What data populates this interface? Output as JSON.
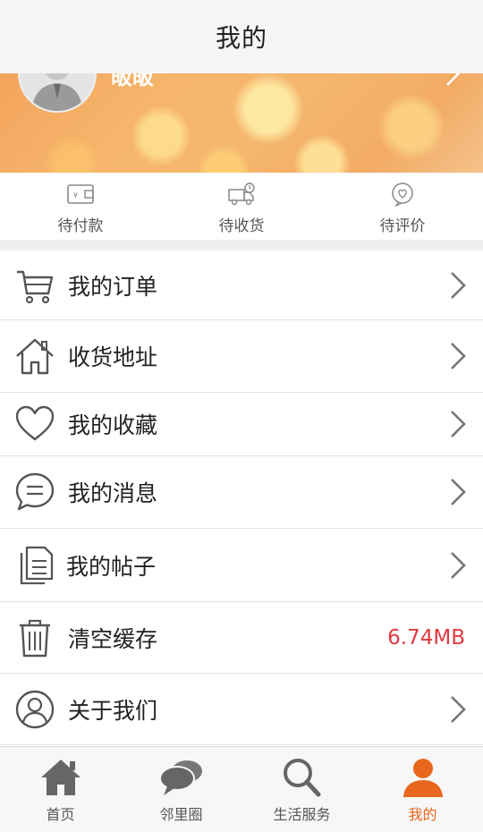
{
  "header": {
    "title": "我的"
  },
  "profile": {
    "username": "皈皈"
  },
  "order_shortcuts": [
    {
      "label": "待付款",
      "icon": "wallet-icon"
    },
    {
      "label": "待收货",
      "icon": "delivery-truck-icon"
    },
    {
      "label": "待评价",
      "icon": "review-heart-bubble-icon"
    }
  ],
  "menu": [
    {
      "label": "我的订单",
      "icon": "cart-icon"
    },
    {
      "label": "收货地址",
      "icon": "home-icon"
    },
    {
      "label": "我的收藏",
      "icon": "heart-icon"
    },
    {
      "label": "我的消息",
      "icon": "message-bubble-icon"
    },
    {
      "label": "我的帖子",
      "icon": "document-icon"
    },
    {
      "label": "清空缓存",
      "icon": "trash-icon",
      "value": "6.74MB"
    },
    {
      "label": "关于我们",
      "icon": "user-circle-icon"
    }
  ],
  "tabbar": [
    {
      "label": "首页",
      "icon": "home-tab-icon",
      "active": false
    },
    {
      "label": "邻里圈",
      "icon": "chat-bubbles-icon",
      "active": false
    },
    {
      "label": "生活服务",
      "icon": "search-icon",
      "active": false
    },
    {
      "label": "我的",
      "icon": "person-icon",
      "active": true
    }
  ],
  "colors": {
    "accent": "#e8671e",
    "value_red": "#e0383e",
    "icon_gray": "#555555"
  }
}
